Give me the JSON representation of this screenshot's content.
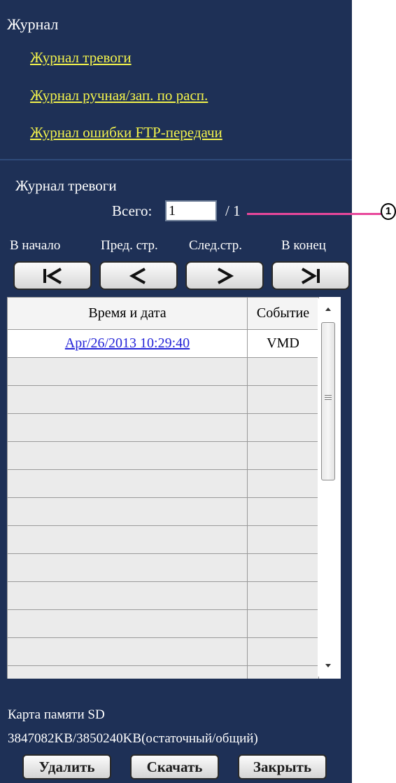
{
  "menu": {
    "title": "Журнал",
    "links": [
      "Журнал тревоги",
      "Журнал ручная/зап. по расп.",
      "Журнал ошибки FTP-передачи"
    ]
  },
  "alarm_log": {
    "title": "Журнал тревоги",
    "total_label": "Всего:",
    "page_value": "1",
    "page_total": "/ 1",
    "callout_number": "1",
    "nav": {
      "first_label": "В начало",
      "prev_label": "Пред. стр.",
      "next_label": "След.стр.",
      "last_label": "В конец",
      "first_icon": "first-page-icon",
      "prev_icon": "previous-page-icon",
      "next_icon": "next-page-icon",
      "last_icon": "last-page-icon"
    },
    "table": {
      "headers": [
        "Время и дата",
        "Событие"
      ],
      "rows": [
        {
          "datetime": "Apr/26/2013 10:29:40",
          "event": "VMD"
        }
      ]
    }
  },
  "sd_card": {
    "label": "Карта памяти SD",
    "value": "3847082KB/3850240KB(остаточный/общий)"
  },
  "buttons": {
    "delete": "Удалить",
    "download": "Скачать",
    "close": "Закрыть"
  },
  "colors": {
    "panel_bg": "#1e3056",
    "link": "#f2f24c",
    "callout": "#e8479b",
    "table_link": "#2424d8"
  }
}
